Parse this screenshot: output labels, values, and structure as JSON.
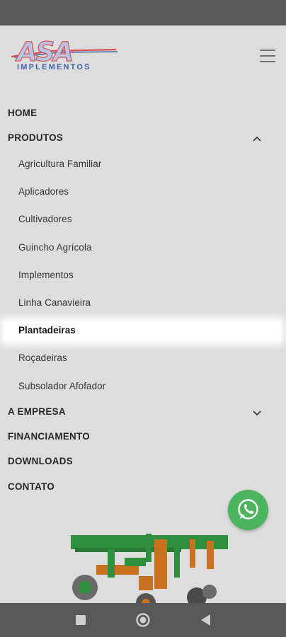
{
  "brand": {
    "logo_main": "ASA",
    "logo_sub": "IMPLEMENTOS",
    "colors": {
      "blue": "#3e63a8",
      "red": "#d9514e",
      "whatsapp": "#4cb45e"
    }
  },
  "menu": {
    "home": "HOME",
    "produtos": "PRODUTOS",
    "produtos_items": [
      "Agricultura Familiar",
      "Aplicadores",
      "Cultivadores",
      "Guincho Agrícola",
      "Implementos",
      "Linha Canavieira",
      "Plantadeiras",
      "Roçadeiras",
      "Subsolador Afofador"
    ],
    "empresa": "A EMPRESA",
    "financiamento": "FINANCIAMENTO",
    "downloads": "DOWNLOADS",
    "contato": "CONTATO",
    "active_item": "Plantadeiras"
  },
  "icons": {
    "hamburger": "menu-icon",
    "expand_open": "chevron-up-icon",
    "expand_closed": "chevron-down-icon",
    "whatsapp": "whatsapp-icon",
    "nav_recents": "square-icon",
    "nav_home": "circle-icon",
    "nav_back": "triangle-back-icon"
  }
}
